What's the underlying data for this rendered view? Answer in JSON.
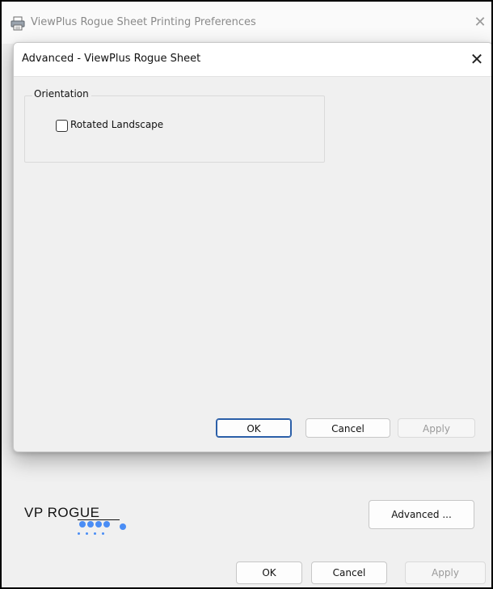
{
  "outer_window": {
    "title": "ViewPlus Rogue Sheet Printing Preferences",
    "close_glyph": "✕",
    "icon": "printer-icon",
    "logo_text": "VP ROGUE",
    "advanced_button": "Advanced ...",
    "ok_button": "OK",
    "cancel_button": "Cancel",
    "apply_button": "Apply"
  },
  "advanced_dialog": {
    "title": "Advanced - ViewPlus Rogue Sheet",
    "close_glyph": "✕",
    "orientation_group": {
      "legend": "Orientation",
      "rotated_landscape_label": "Rotated Landscape",
      "rotated_landscape_checked": false
    },
    "ok_button": "OK",
    "cancel_button": "Cancel",
    "apply_button": "Apply"
  },
  "colors": {
    "default_button_border": "#2b5fa8",
    "logo_dots": "#4a8df5"
  }
}
